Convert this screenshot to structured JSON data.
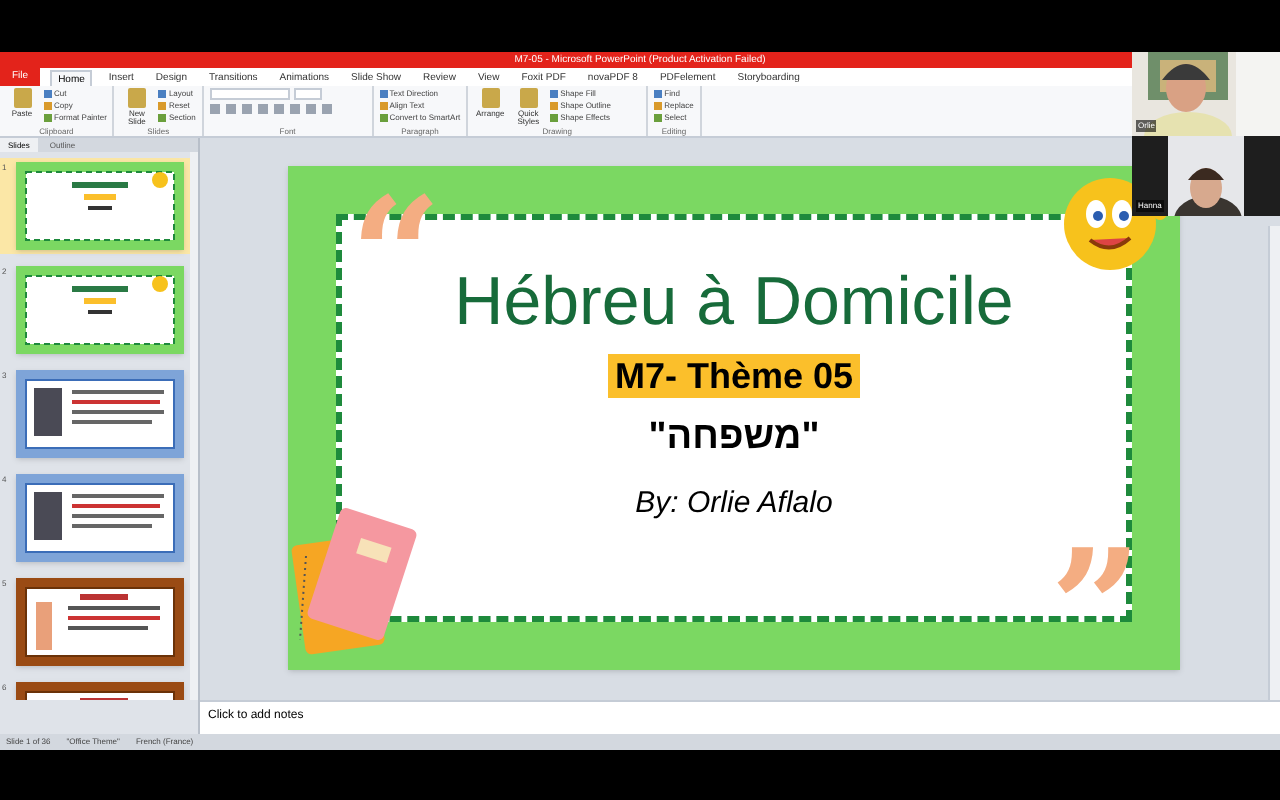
{
  "window": {
    "title": "M7-05  -  Microsoft PowerPoint (Product Activation Failed)"
  },
  "ribbon_tabs": [
    {
      "label": "File",
      "kind": "file",
      "selected": false
    },
    {
      "label": "Home",
      "kind": "tab",
      "selected": true
    },
    {
      "label": "Insert",
      "kind": "tab",
      "selected": false
    },
    {
      "label": "Design",
      "kind": "tab",
      "selected": false
    },
    {
      "label": "Transitions",
      "kind": "tab",
      "selected": false
    },
    {
      "label": "Animations",
      "kind": "tab",
      "selected": false
    },
    {
      "label": "Slide Show",
      "kind": "tab",
      "selected": false
    },
    {
      "label": "Review",
      "kind": "tab",
      "selected": false
    },
    {
      "label": "View",
      "kind": "tab",
      "selected": false
    },
    {
      "label": "Foxit PDF",
      "kind": "tab",
      "selected": false
    },
    {
      "label": "novaPDF 8",
      "kind": "tab",
      "selected": false
    },
    {
      "label": "PDFelement",
      "kind": "tab",
      "selected": false
    },
    {
      "label": "Storyboarding",
      "kind": "tab",
      "selected": false
    }
  ],
  "ribbon_groups": [
    {
      "label": "Clipboard",
      "big": "Paste",
      "commands": [
        "Cut",
        "Copy",
        "Format Painter"
      ]
    },
    {
      "label": "Slides",
      "big": "New Slide",
      "commands": [
        "Layout",
        "Reset",
        "Section"
      ]
    },
    {
      "label": "Font"
    },
    {
      "label": "Paragraph",
      "commands": [
        "Text Direction",
        "Align Text",
        "Convert to SmartArt"
      ]
    },
    {
      "label": "Drawing",
      "big": "Arrange",
      "big2": "Quick Styles",
      "commands": [
        "Shape Fill",
        "Shape Outline",
        "Shape Effects"
      ]
    },
    {
      "label": "Editing",
      "commands": [
        "Find",
        "Replace",
        "Select"
      ]
    }
  ],
  "slide_panel": {
    "tabs": [
      {
        "label": "Slides",
        "selected": true
      },
      {
        "label": "Outline",
        "selected": false
      }
    ],
    "thumbnails": [
      {
        "number": "1",
        "kind": "green",
        "selected": true
      },
      {
        "number": "2",
        "kind": "green",
        "selected": false
      },
      {
        "number": "3",
        "kind": "blue",
        "selected": false
      },
      {
        "number": "4",
        "kind": "blue",
        "selected": false
      },
      {
        "number": "5",
        "kind": "brown",
        "selected": false
      },
      {
        "number": "6",
        "kind": "brown",
        "selected": false
      }
    ]
  },
  "slide": {
    "quote_open": "“",
    "quote_close": "”",
    "title": "Hébreu à Domicile",
    "subtitle": "M7- Thème 05",
    "hebrew": "\"משפחה\"",
    "author": "By: Orlie Aflalo"
  },
  "notes": {
    "placeholder": "Click to add notes"
  },
  "status_bar": [
    "Slide 1 of 36",
    "\"Office Theme\"",
    "French (France)"
  ],
  "participants": [
    {
      "name": "Orlie"
    },
    {
      "name": "Hanna"
    }
  ]
}
